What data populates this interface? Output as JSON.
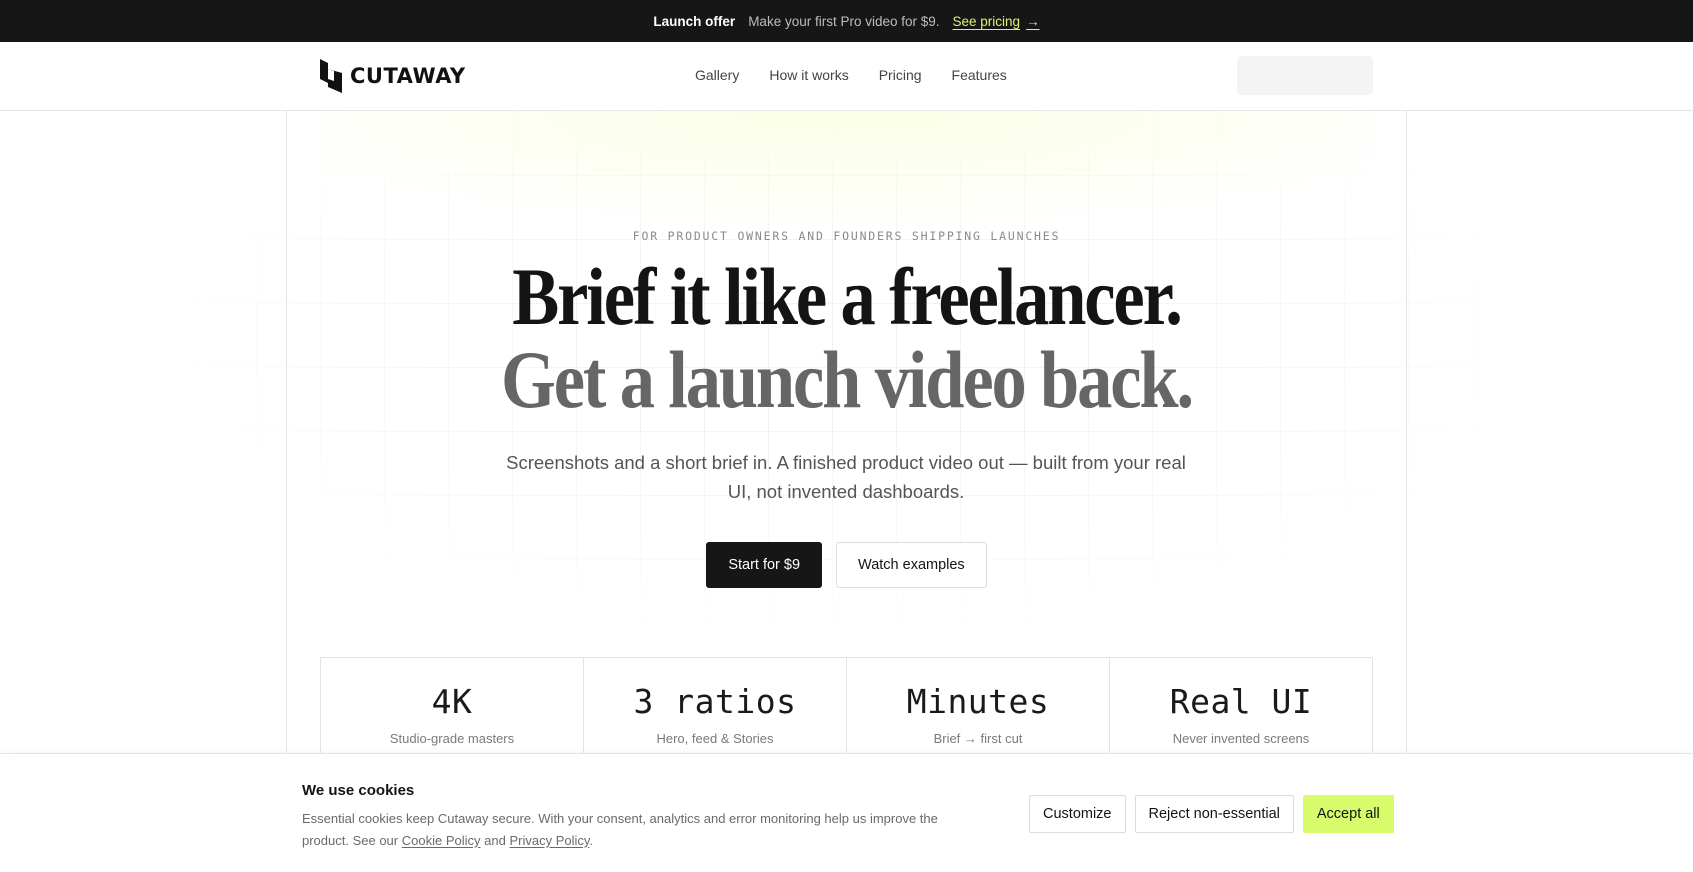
{
  "announcement": {
    "title": "Launch offer",
    "text": "Make your first Pro video for $9.",
    "link_label": "See pricing",
    "link_arrow": "→"
  },
  "header": {
    "logo_text": "CUTAWAY",
    "nav": [
      "Gallery",
      "How it works",
      "Pricing",
      "Features"
    ]
  },
  "hero": {
    "eyebrow": "FOR PRODUCT OWNERS AND FOUNDERS SHIPPING LAUNCHES",
    "headline_line1": "Brief it like a freelancer.",
    "headline_line2": "Get a launch video back.",
    "subhead": "Screenshots and a short brief in. A finished product video out — built from your real UI, not invented dashboards.",
    "primary_cta": "Start for $9",
    "secondary_cta": "Watch examples"
  },
  "stats": [
    {
      "value": "4K",
      "label": "Studio-grade masters"
    },
    {
      "value": "3 ratios",
      "label": "Hero, feed & Stories"
    },
    {
      "value": "Minutes",
      "label": "Brief → first cut"
    },
    {
      "value": "Real UI",
      "label": "Never invented screens"
    }
  ],
  "cookie": {
    "title": "We use cookies",
    "text_before": "Essential cookies keep Cutaway secure. With your consent, analytics and error monitoring help us improve the product. See our",
    "cookie_policy": "Cookie Policy",
    "and": "and",
    "privacy_policy": "Privacy Policy",
    "period": ".",
    "customize": "Customize",
    "reject": "Reject non-essential",
    "accept": "Accept all"
  },
  "colors": {
    "accent": "#d7fb6b",
    "link_accent": "#d7f572",
    "dark": "#161616"
  }
}
